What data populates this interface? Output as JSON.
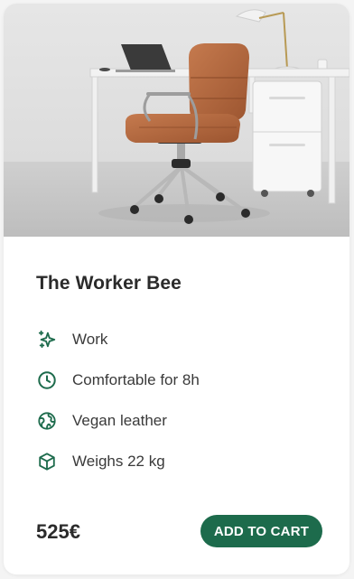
{
  "product": {
    "title": "The Worker Bee",
    "price": "525€",
    "cta_label": "ADD TO CART"
  },
  "features": [
    {
      "icon": "sparkles-icon",
      "label": "Work"
    },
    {
      "icon": "clock-icon",
      "label": "Comfortable for 8h"
    },
    {
      "icon": "globe-icon",
      "label": "Vegan leather"
    },
    {
      "icon": "box-icon",
      "label": "Weighs 22 kg"
    }
  ],
  "colors": {
    "accent": "#1d6b4c",
    "text": "#2b2b2b",
    "card_bg": "#ffffff"
  }
}
